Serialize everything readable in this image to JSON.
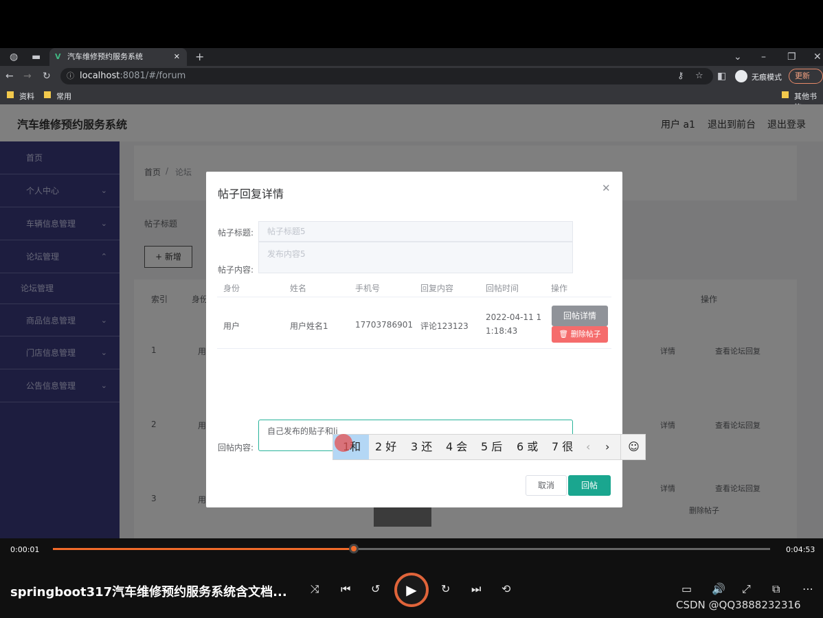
{
  "browser": {
    "tab_title": "汽车维修预约服务系统",
    "url_host": "localhost",
    "url_rest": ":8081/#/forum",
    "incognito_label": "无痕模式",
    "update_label": "更新",
    "bookmarks": [
      "资料",
      "常用"
    ],
    "other_bookmarks": "其他书签"
  },
  "app": {
    "brand": "汽车维修预约服务系统",
    "header_links": [
      "用户 a1",
      "退出到前台",
      "退出登录"
    ],
    "sidebar": [
      {
        "label": "首页"
      },
      {
        "label": "个人中心"
      },
      {
        "label": "车辆信息管理"
      },
      {
        "label": "论坛管理"
      },
      {
        "label": "论坛管理"
      },
      {
        "label": "商品信息管理"
      },
      {
        "label": "门店信息管理"
      },
      {
        "label": "公告信息管理"
      }
    ],
    "breadcrumb": [
      "首页",
      "论坛"
    ],
    "search_label": "帖子标题",
    "add_button": "+ 新增",
    "table_headers": [
      "索引",
      "身份",
      "操作"
    ],
    "rows": [
      {
        "index": "1",
        "role": "用",
        "detail": "详情",
        "view": "查看论坛回复"
      },
      {
        "index": "2",
        "role": "用",
        "detail": "详情",
        "view": "查看论坛回复"
      },
      {
        "index": "3",
        "role": "用",
        "detail": "详情",
        "view": "查看论坛回复",
        "delete": "删除帖子"
      }
    ]
  },
  "dialog": {
    "title": "帖子回复详情",
    "post_title_label": "帖子标题:",
    "post_title_placeholder": "帖子标题5",
    "post_content_label": "帖子内容:",
    "post_content_placeholder": "发布内容5",
    "columns": [
      "身份",
      "姓名",
      "手机号",
      "回复内容",
      "回帖时间",
      "操作"
    ],
    "reply_row": {
      "role": "用户",
      "name": "用户姓名1",
      "phone": "17703786901",
      "content": "评论123123",
      "time_line1": "2022-04-11 1",
      "time_line2": "1:18:43",
      "detail_btn": "回帖详情",
      "delete_btn": "删除帖子"
    },
    "reply_label": "回帖内容:",
    "reply_value": "自己发布的贴子和li",
    "cancel": "取消",
    "submit": "回帖"
  },
  "ime": {
    "candidates": [
      "1和",
      "2 好",
      "3 还",
      "4 会",
      "5 后",
      "6 或",
      "7 很"
    ]
  },
  "player": {
    "current_time": "0:00:01",
    "total_time": "0:04:53",
    "progress": 0.42,
    "title": "springboot317汽车维修预约服务系统含文档...",
    "watermark": "CSDN @QQ3888232316"
  }
}
